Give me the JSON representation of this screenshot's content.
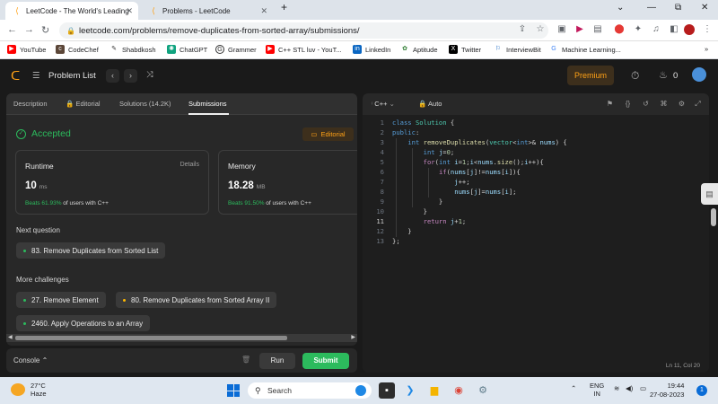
{
  "browser": {
    "tabs": [
      {
        "title": "LeetCode - The World's Leading",
        "active": true
      },
      {
        "title": "Problems - LeetCode",
        "active": false
      }
    ],
    "new_tab": "+",
    "url": "leetcode.com/problems/remove-duplicates-from-sorted-array/submissions/",
    "bookmarks": [
      "YouTube",
      "CodeChef",
      "Shabdkosh",
      "ChatGPT",
      "Grammer",
      "C++ STL luv - YouT...",
      "LinkedIn",
      "Aptitude",
      "Twitter",
      "InterviewBit",
      "Machine Learning..."
    ]
  },
  "lc_nav": {
    "problem_list": "Problem List",
    "premium": "Premium",
    "streak": "0"
  },
  "left": {
    "tabs": [
      "Description",
      "Editorial",
      "Solutions (14.2K)",
      "Submissions"
    ],
    "accepted": "Accepted",
    "editorial_btn": "Editorial",
    "runtime": {
      "title": "Runtime",
      "details": "Details",
      "value": "10",
      "unit": "ms",
      "beats_pct": "Beats 61.93%",
      "beats_rest": "of users with C++"
    },
    "memory": {
      "title": "Memory",
      "value": "18.28",
      "unit": "MB",
      "beats_pct": "Beats 91.50%",
      "beats_rest": "of users with C++"
    },
    "next_question_label": "Next question",
    "next_question": "83. Remove Duplicates from Sorted List",
    "more_challenges_label": "More challenges",
    "challenges": [
      "27. Remove Element",
      "80. Remove Duplicates from Sorted Array II",
      "2460. Apply Operations to an Array"
    ]
  },
  "console": {
    "label": "Console",
    "run": "Run",
    "submit": "Submit"
  },
  "editor": {
    "language": "C++",
    "mode": "Auto",
    "status": "Ln 11, Col 20",
    "line_numbers": [
      "1",
      "2",
      "3",
      "4",
      "5",
      "6",
      "7",
      "8",
      "9",
      "10",
      "11",
      "12",
      "13"
    ]
  },
  "taskbar": {
    "temp": "27°C",
    "weather": "Haze",
    "search": "Search",
    "lang1": "ENG",
    "lang2": "IN",
    "time": "19:44",
    "date": "27-08-2023",
    "notif_count": "1"
  },
  "colors": {
    "accent_green": "#2cbb5d",
    "accent_orange": "#ffa116"
  }
}
